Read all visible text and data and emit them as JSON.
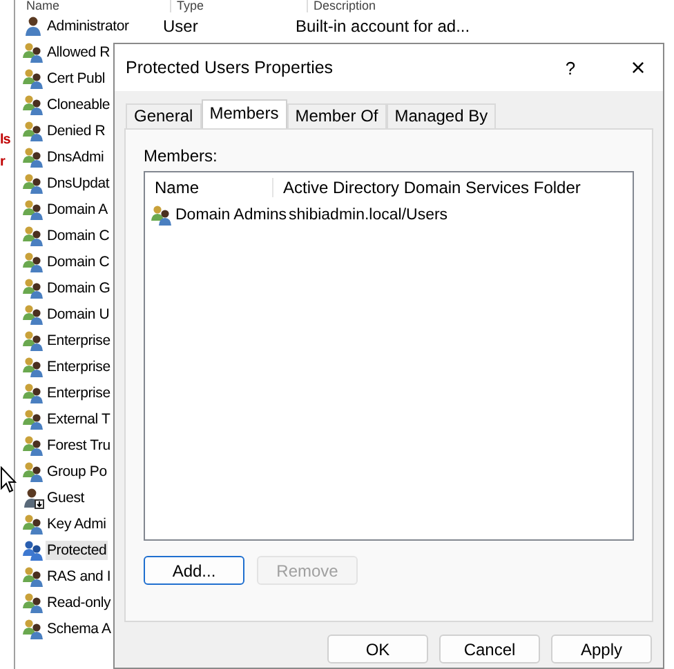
{
  "background_list": {
    "columns": [
      "Name",
      "Type",
      "Description"
    ],
    "side_fragments": [
      "ls",
      "r"
    ],
    "rows": [
      {
        "name": "Administrator",
        "type": "User",
        "description": "Built-in account for ad...",
        "kind": "user",
        "selected": false
      },
      {
        "name": "Allowed R",
        "kind": "group",
        "selected": false
      },
      {
        "name": "Cert Publ",
        "kind": "group",
        "selected": false
      },
      {
        "name": "Cloneable",
        "kind": "group",
        "selected": false
      },
      {
        "name": "Denied R",
        "kind": "group",
        "selected": false
      },
      {
        "name": "DnsAdmi",
        "kind": "group",
        "selected": false
      },
      {
        "name": "DnsUpdat",
        "kind": "group",
        "selected": false
      },
      {
        "name": "Domain A",
        "kind": "group",
        "selected": false
      },
      {
        "name": "Domain C",
        "kind": "group",
        "selected": false
      },
      {
        "name": "Domain C",
        "kind": "group",
        "selected": false
      },
      {
        "name": "Domain G",
        "kind": "group",
        "selected": false
      },
      {
        "name": "Domain U",
        "kind": "group",
        "selected": false
      },
      {
        "name": "Enterprise",
        "kind": "group",
        "selected": false
      },
      {
        "name": "Enterprise",
        "kind": "group",
        "selected": false
      },
      {
        "name": "Enterprise",
        "kind": "group",
        "selected": false
      },
      {
        "name": "External T",
        "kind": "group",
        "selected": false
      },
      {
        "name": "Forest Tru",
        "kind": "group",
        "selected": false
      },
      {
        "name": "Group Po",
        "kind": "group",
        "selected": false
      },
      {
        "name": "Guest",
        "kind": "disabled-user",
        "selected": false
      },
      {
        "name": "Key Admi",
        "kind": "group",
        "selected": false
      },
      {
        "name": "Protected",
        "kind": "protected-group",
        "selected": true
      },
      {
        "name": "RAS and I",
        "kind": "group",
        "selected": false
      },
      {
        "name": "Read-only",
        "kind": "group",
        "selected": false
      },
      {
        "name": "Schema A",
        "kind": "group",
        "selected": false
      }
    ]
  },
  "dialog": {
    "title": "Protected Users Properties",
    "help": "?",
    "close": "×",
    "tabs": [
      {
        "label": "General",
        "selected": false
      },
      {
        "label": "Members",
        "selected": true
      },
      {
        "label": "Member Of",
        "selected": false
      },
      {
        "label": "Managed By",
        "selected": false
      }
    ],
    "members_label": "Members:",
    "members_table": {
      "columns": [
        "Name",
        "Active Directory Domain Services Folder"
      ],
      "rows": [
        {
          "name": "Domain Admins",
          "folder": "shibiadmin.local/Users"
        }
      ]
    },
    "member_buttons": [
      {
        "label": "Add...",
        "disabled": false,
        "focused": true
      },
      {
        "label": "Remove",
        "disabled": true,
        "focused": false
      }
    ],
    "buttons": [
      {
        "label": "OK"
      },
      {
        "label": "Cancel"
      },
      {
        "label": "Apply"
      }
    ]
  }
}
